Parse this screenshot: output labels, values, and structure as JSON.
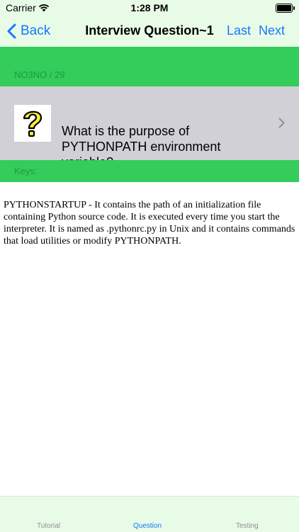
{
  "status_bar": {
    "carrier": "Carrier",
    "time": "1:28 PM"
  },
  "nav": {
    "back_label": "Back",
    "title": "Interview Question~1",
    "last_label": "Last",
    "next_label": "Next"
  },
  "header": {
    "counter": "NO3NO / 29"
  },
  "question": {
    "text": "What is the purpose of PYTHONPATH environment variable?",
    "icon": "question-mark-icon"
  },
  "keys": {
    "label": "Keys:"
  },
  "answer": {
    "text": "PYTHONSTARTUP - It contains the path of an initialization file containing Python source code. It is executed every time you start the interpreter. It is named as .pythonrc.py in Unix and it contains commands that load utilities or modify PYTHONPATH."
  },
  "tabs": [
    {
      "label": "Tutorial",
      "active": false
    },
    {
      "label": "Question",
      "active": true
    },
    {
      "label": "Testing",
      "active": false
    }
  ],
  "colors": {
    "accent": "#1677ff",
    "green": "#34cc5a",
    "header_bg": "#e8fbe6",
    "row_bg": "#d0d0d6"
  }
}
